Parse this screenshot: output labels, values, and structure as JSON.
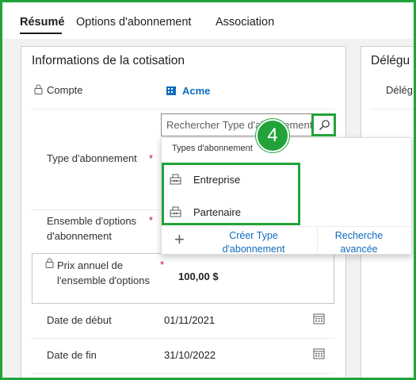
{
  "tabs": [
    {
      "label": "Résumé",
      "active": true
    },
    {
      "label": "Options d'abonnement",
      "active": false
    },
    {
      "label": "Association",
      "active": false
    }
  ],
  "section": {
    "title": "Informations de la cotisation"
  },
  "right_section": {
    "title": "Délégu",
    "sub_label": "Délég"
  },
  "fields": {
    "compte_label": "Compte",
    "compte_value": "Acme",
    "type_label": "Type d'abonnement",
    "ensemble_label_1": "Ensemble d'options",
    "ensemble_label_2": "d'abonnement",
    "prix_label_1": "Prix annuel de",
    "prix_label_2": "l'ensemble d'options",
    "prix_value": "100,00 $",
    "date_debut_label": "Date de début",
    "date_debut_value": "01/11/2021",
    "date_fin_label": "Date de fin",
    "date_fin_value": "31/10/2022",
    "required_mark": "*"
  },
  "lookup": {
    "placeholder": "Rechercher Type d'abonnement"
  },
  "callout": {
    "number": "4"
  },
  "dropdown": {
    "header": "Types d'abonnement",
    "items": [
      "Entreprise",
      "Partenaire"
    ],
    "create_label_1": "Créer Type",
    "create_label_2": "d'abonnement",
    "advanced_label_1": "Recherche",
    "advanced_label_2": "avancée"
  },
  "colors": {
    "highlight": "#22a33a",
    "link": "#0f6cbd",
    "required": "#c50f1f"
  }
}
